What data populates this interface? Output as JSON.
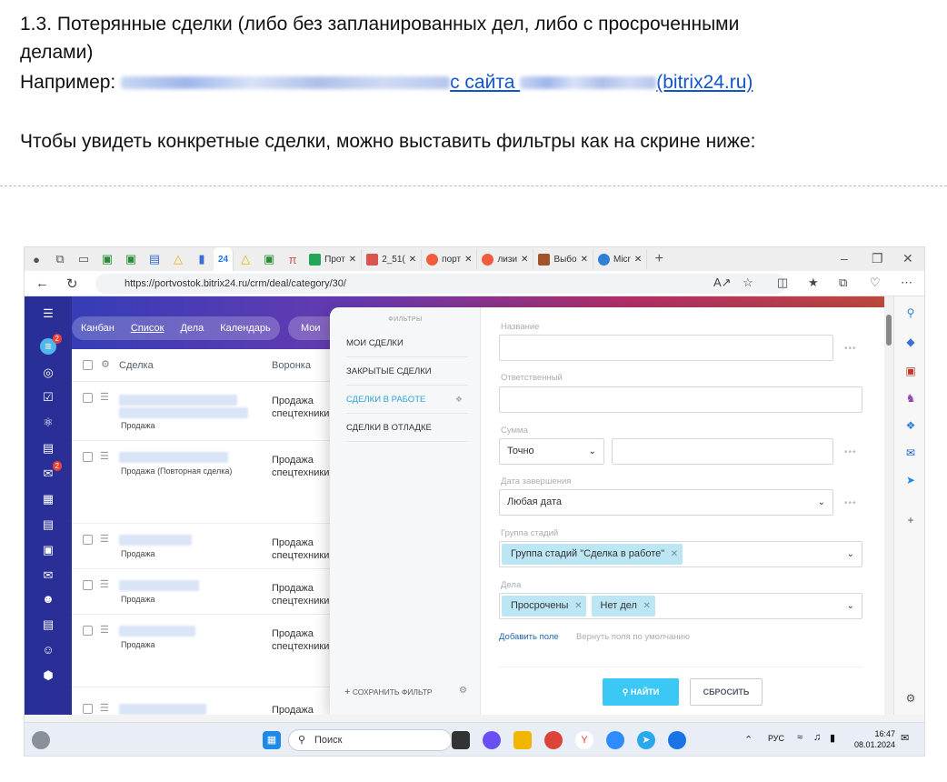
{
  "document": {
    "heading_line1": "1.3.  Потерянные сделки (либо без запланированных дел, либо с просроченными",
    "heading_line2": "делами)",
    "example_prefix": "Например: ",
    "example_link_mid": "с сайта ",
    "example_link_end": "(bitrix24.ru)",
    "instruction": "Чтобы увидеть конкретные сделки, можно выставить фильтры как на скрине ниже:"
  },
  "browser": {
    "tabs": [
      {
        "label": "24",
        "color": "#1b73e8",
        "active": true
      },
      {
        "label": "Прот",
        "color": "#23a55a",
        "active": false
      },
      {
        "label": "2_51(",
        "color": "#d9534f",
        "active": false
      },
      {
        "label": "порт",
        "color": "#f25c3d",
        "active": false
      },
      {
        "label": "лизи",
        "color": "#f25c3d",
        "active": false
      },
      {
        "label": "Выбо",
        "color": "#a0522d",
        "active": false
      },
      {
        "label": "Micr",
        "color": "#2f7ed8",
        "active": false
      }
    ],
    "url": "https://portvostok.bitrix24.ru/crm/deal/category/30/"
  },
  "crm": {
    "view_tabs": [
      "Канбан",
      "Список",
      "Дела",
      "Календарь"
    ],
    "active_view": "Список",
    "my_button": "Мои",
    "columns": {
      "deal": "Сделка",
      "funnel": "Воронка"
    },
    "rows": [
      {
        "stage": "Продажа",
        "funnel_line1": "Продажа",
        "funnel_line2": "спецтехники"
      },
      {
        "stage": "Продажа (Повторная сделка)",
        "funnel_line1": "Продажа",
        "funnel_line2": "спецтехники"
      },
      {
        "stage": "Продажа",
        "funnel_line1": "Продажа",
        "funnel_line2": "спецтехники"
      },
      {
        "stage": "Продажа",
        "funnel_line1": "Продажа",
        "funnel_line2": "спецтехники"
      },
      {
        "stage": "Продажа",
        "funnel_line1": "Продажа",
        "funnel_line2": "спецтехники"
      },
      {
        "stage": "",
        "funnel_line1": "Продажа",
        "funnel_line2": ""
      }
    ],
    "badges": {
      "filter": "2",
      "chat": "2"
    }
  },
  "filter": {
    "title": "ФИЛЬТРЫ",
    "presets": [
      "МОИ СДЕЛКИ",
      "ЗАКРЫТЫЕ СДЕЛКИ",
      "СДЕЛКИ В РАБОТЕ",
      "СДЕЛКИ В ОТЛАДКЕ"
    ],
    "active_preset": "СДЕЛКИ В РАБОТЕ",
    "save_filter": "СОХРАНИТЬ ФИЛЬТР",
    "fields": {
      "name_label": "Название",
      "name_value": "",
      "responsible_label": "Ответственный",
      "responsible_value": "",
      "sum_label": "Сумма",
      "sum_mode": "Точно",
      "sum_value": "",
      "date_label": "Дата завершения",
      "date_value": "Любая дата",
      "stage_group_label": "Группа стадий",
      "stage_group_tags": [
        "Группа стадий \"Сделка в работе\""
      ],
      "activities_label": "Дела",
      "activities_tags": [
        "Просрочены",
        "Нет дел"
      ]
    },
    "add_field": "Добавить поле",
    "restore_fields": "Вернуть поля по умолчанию",
    "find_button": "НАЙТИ",
    "reset_button": "СБРОСИТЬ"
  },
  "taskbar": {
    "search_placeholder": "Поиск",
    "lang": "РУС",
    "time": "16:47",
    "date": "08.01.2024"
  },
  "colors": {
    "link": "#1155cc",
    "bitrix_accent": "#3bc8f5",
    "tag_bg": "#bce6f4",
    "active_preset": "#2fa4d7"
  }
}
